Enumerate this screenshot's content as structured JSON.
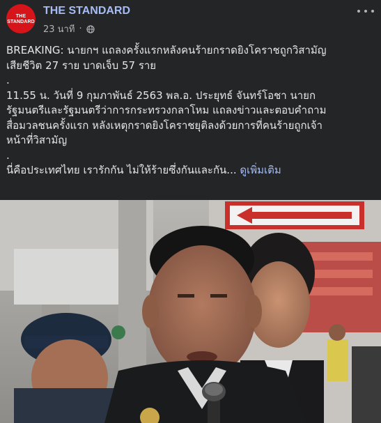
{
  "post": {
    "page_name": "THE STANDARD",
    "avatar": {
      "line1": "THE",
      "line2": "STANDARD"
    },
    "time": "23 นาที",
    "separator": "·",
    "privacy_icon": "globe-icon",
    "more_icon": "more-options-icon",
    "text": {
      "line1": "BREAKING: นายกฯ แถลงครั้งแรกหลังคนร้ายกราดยิงโคราชถูกวิสามัญ",
      "line2": "เสียชีวิต 27 ราย บาดเจ็บ 57 ราย",
      "spacer1": ".",
      "line3": "11.55 น. วันที่ 9 กุมภาพันธ์ 2563 พล.อ. ประยุทธ์ จันทร์โอชา นายก",
      "line4": "รัฐมนตรีและรัฐมนตรีว่าการกระทรวงกลาโหม แถลงข่าวและตอบคำถาม",
      "line5": "สื่อมวลชนครั้งแรก หลังเหตุกราดยิงโคราชยุติลงด้วยการที่คนร้ายถูกเจ้า",
      "line6": "หน้าที่วิสามัญ",
      "spacer2": ".",
      "line7": "นี่คือประเทศไทย เรารักกัน ไม่ให้ร้ายซึ่งกันและกัน...",
      "see_more": "ดูเพิ่มเติม"
    },
    "photo": {
      "description_icon": "news-photo",
      "colors": {
        "brand_red": "#d7141a",
        "link_blue": "#a6bcf5",
        "background": "#242526"
      }
    }
  }
}
